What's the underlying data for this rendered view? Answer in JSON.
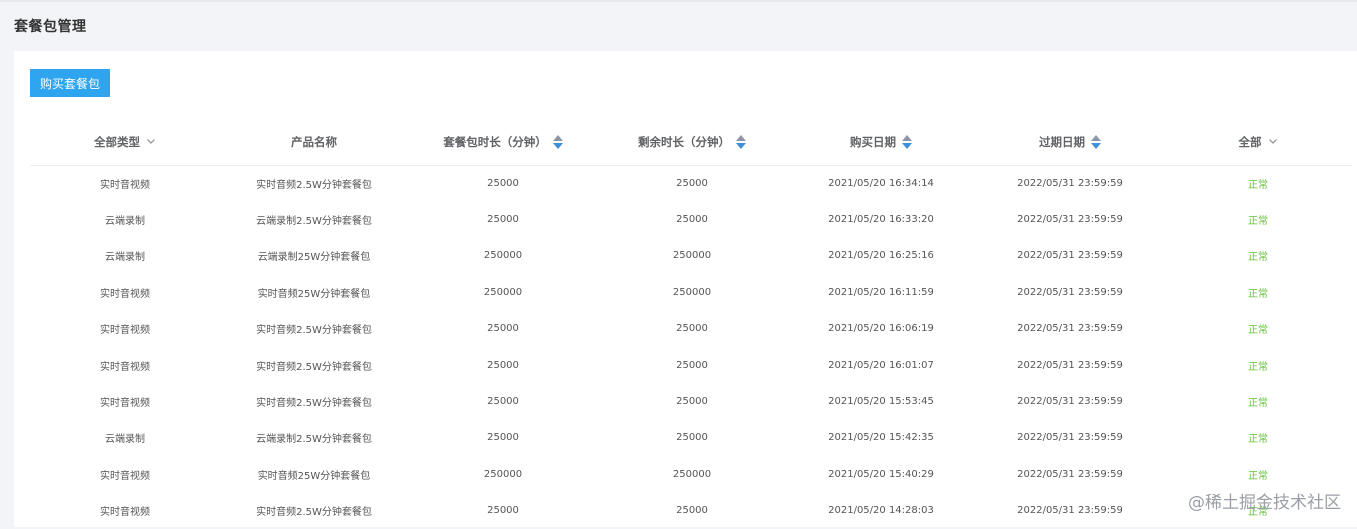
{
  "page": {
    "title": "套餐包管理"
  },
  "toolbar": {
    "buy_label": "购买套餐包"
  },
  "table": {
    "columns": [
      {
        "label": "全部类型",
        "control": "dropdown"
      },
      {
        "label": "产品名称",
        "control": "none"
      },
      {
        "label": "套餐包时长（分钟）",
        "control": "sort"
      },
      {
        "label": "剩余时长（分钟）",
        "control": "sort"
      },
      {
        "label": "购买日期",
        "control": "sort"
      },
      {
        "label": "过期日期",
        "control": "sort"
      },
      {
        "label": "全部",
        "control": "dropdown"
      }
    ],
    "rows": [
      [
        "实时音视频",
        "实时音频2.5W分钟套餐包",
        "25000",
        "25000",
        "2021/05/20 16:34:14",
        "2022/05/31 23:59:59",
        "正常"
      ],
      [
        "云端录制",
        "云端录制2.5W分钟套餐包",
        "25000",
        "25000",
        "2021/05/20 16:33:20",
        "2022/05/31 23:59:59",
        "正常"
      ],
      [
        "云端录制",
        "云端录制25W分钟套餐包",
        "250000",
        "250000",
        "2021/05/20 16:25:16",
        "2022/05/31 23:59:59",
        "正常"
      ],
      [
        "实时音视频",
        "实时音频25W分钟套餐包",
        "250000",
        "250000",
        "2021/05/20 16:11:59",
        "2022/05/31 23:59:59",
        "正常"
      ],
      [
        "实时音视频",
        "实时音频2.5W分钟套餐包",
        "25000",
        "25000",
        "2021/05/20 16:06:19",
        "2022/05/31 23:59:59",
        "正常"
      ],
      [
        "实时音视频",
        "实时音频2.5W分钟套餐包",
        "25000",
        "25000",
        "2021/05/20 16:01:07",
        "2022/05/31 23:59:59",
        "正常"
      ],
      [
        "实时音视频",
        "实时音频2.5W分钟套餐包",
        "25000",
        "25000",
        "2021/05/20 15:53:45",
        "2022/05/31 23:59:59",
        "正常"
      ],
      [
        "云端录制",
        "云端录制2.5W分钟套餐包",
        "25000",
        "25000",
        "2021/05/20 15:42:35",
        "2022/05/31 23:59:59",
        "正常"
      ],
      [
        "实时音视频",
        "实时音频25W分钟套餐包",
        "250000",
        "250000",
        "2021/05/20 15:40:29",
        "2022/05/31 23:59:59",
        "正常"
      ],
      [
        "实时音视频",
        "实时音频2.5W分钟套餐包",
        "25000",
        "25000",
        "2021/05/20 14:28:03",
        "2022/05/31 23:59:59",
        "正常"
      ]
    ]
  },
  "watermark": "@稀土掘金技术社区",
  "colors": {
    "accent": "#2fa4ef",
    "status_ok": "#67c23a"
  },
  "icons": {
    "dropdown": "chevron-down-icon",
    "sort": "sort-icon"
  }
}
